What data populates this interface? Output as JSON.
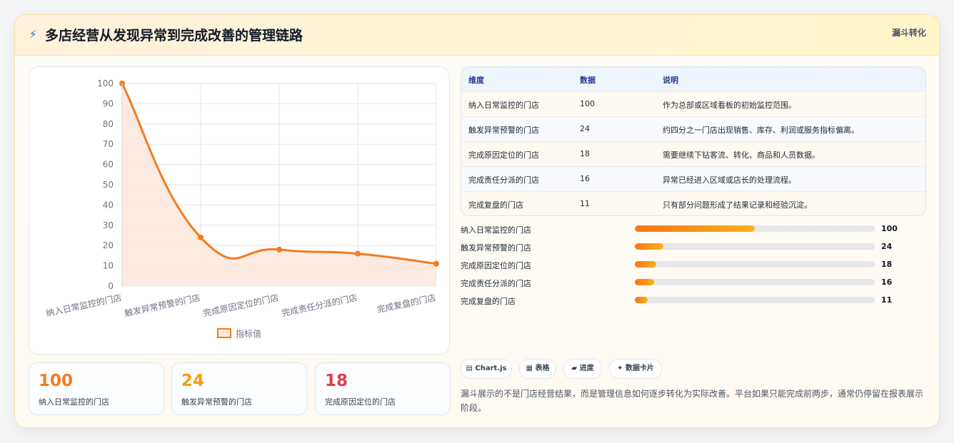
{
  "header": {
    "icon": "bolt-icon",
    "title": "多店经营从发现异常到完成改善的管理链路",
    "tag": "漏斗转化"
  },
  "chart_data": {
    "type": "line",
    "categories": [
      "纳入日常监控的门店",
      "触发异常预警的门店",
      "完成原因定位的门店",
      "完成责任分派的门店",
      "完成复盘的门店"
    ],
    "series": [
      {
        "name": "指标值",
        "values": [
          100,
          24,
          18,
          16,
          11
        ]
      }
    ],
    "ylim": [
      0,
      100
    ],
    "yticks": [
      0,
      10,
      20,
      30,
      40,
      50,
      60,
      70,
      80,
      90,
      100
    ],
    "grid": true,
    "legend": "bottom",
    "colors": {
      "line": "#f47b20",
      "fill": "#fde8dc"
    }
  },
  "stats": [
    {
      "value": "100",
      "label": "纳入日常监控的门店",
      "color": "#f47b20"
    },
    {
      "value": "24",
      "label": "触发异常预警的门店",
      "color": "#f59e0b"
    },
    {
      "value": "18",
      "label": "完成原因定位的门店",
      "color": "#e0404a"
    }
  ],
  "table": {
    "headers": [
      "维度",
      "数据",
      "说明"
    ],
    "rows": [
      [
        "纳入日常监控的门店",
        "100",
        "作为总部或区域看板的初始监控范围。"
      ],
      [
        "触发异常预警的门店",
        "24",
        "约四分之一门店出现销售、库存、利润或服务指标偏离。"
      ],
      [
        "完成原因定位的门店",
        "18",
        "需要继续下钻客流、转化、商品和人员数据。"
      ],
      [
        "完成责任分派的门店",
        "16",
        "异常已经进入区域或店长的处理流程。"
      ],
      [
        "完成复盘的门店",
        "11",
        "只有部分问题形成了结果记录和经验沉淀。"
      ]
    ]
  },
  "progress": [
    {
      "label": "纳入日常监控的门店",
      "value": 100,
      "display": "100"
    },
    {
      "label": "触发异常预警的门店",
      "value": 24,
      "display": "24"
    },
    {
      "label": "完成原因定位的门店",
      "value": 18,
      "display": "18"
    },
    {
      "label": "完成责任分派的门店",
      "value": 16,
      "display": "16"
    },
    {
      "label": "完成复盘的门店",
      "value": 11,
      "display": "11"
    }
  ],
  "progress_max": 200,
  "chips": [
    {
      "icon": "chart-icon",
      "glyph": "▤",
      "label": "Chart.js"
    },
    {
      "icon": "table-icon",
      "glyph": "▦",
      "label": "表格"
    },
    {
      "icon": "progress-icon",
      "glyph": "▰",
      "label": "进度"
    },
    {
      "icon": "sparkle-icon",
      "glyph": "✦",
      "label": "数据卡片"
    }
  ],
  "note": "漏斗展示的不是门店经营结果，而是管理信息如何逐步转化为实际改善。平台如果只能完成前两步，通常仍停留在报表展示阶段。"
}
